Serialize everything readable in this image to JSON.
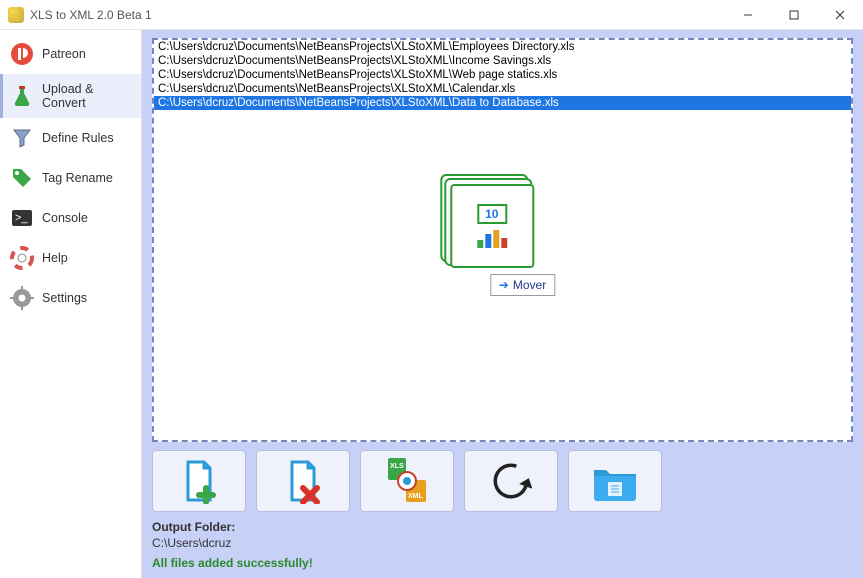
{
  "window": {
    "title": "XLS to XML 2.0 Beta 1"
  },
  "sidebar": {
    "items": [
      {
        "label": "Patreon"
      },
      {
        "label": "Upload & Convert"
      },
      {
        "label": "Define Rules"
      },
      {
        "label": "Tag Rename"
      },
      {
        "label": "Console"
      },
      {
        "label": "Help"
      },
      {
        "label": "Settings"
      }
    ]
  },
  "files": [
    "C:\\Users\\dcruz\\Documents\\NetBeansProjects\\XLStoXML\\Employees Directory.xls",
    "C:\\Users\\dcruz\\Documents\\NetBeansProjects\\XLStoXML\\Income Savings.xls",
    "C:\\Users\\dcruz\\Documents\\NetBeansProjects\\XLStoXML\\Web page statics.xls",
    "C:\\Users\\dcruz\\Documents\\NetBeansProjects\\XLStoXML\\Calendar.xls",
    "C:\\Users\\dcruz\\Documents\\NetBeansProjects\\XLStoXML\\Data to Database.xls"
  ],
  "selected_index": 4,
  "center_badge": "10",
  "mover_label": "Mover",
  "output": {
    "label": "Output Folder:",
    "path": "C:\\Users\\dcruz",
    "status": "All files added successfully!"
  }
}
